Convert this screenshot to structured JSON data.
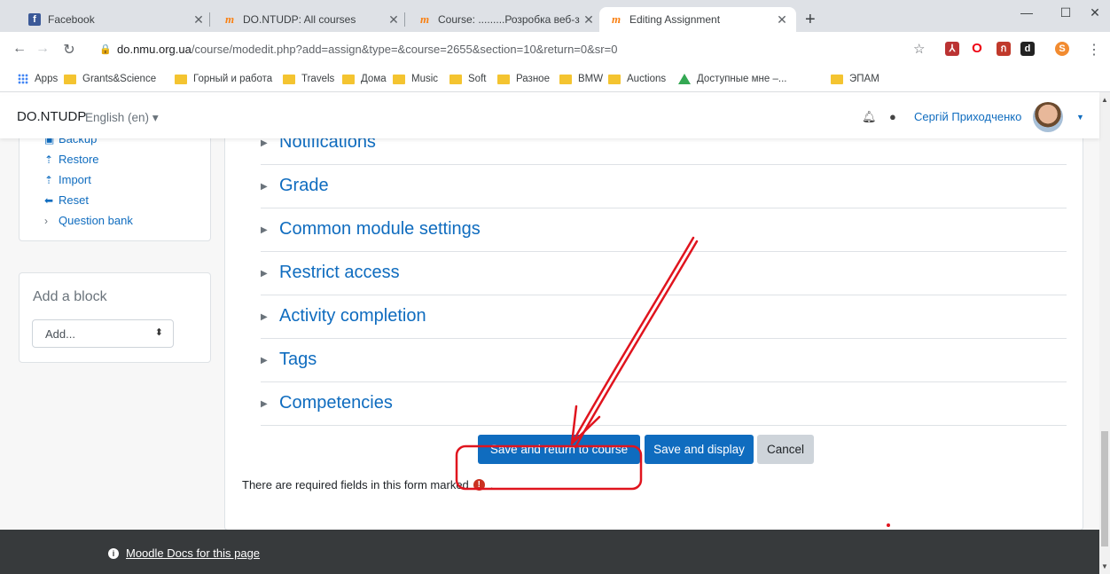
{
  "browser": {
    "tabs": [
      {
        "title": "Facebook",
        "icon": "facebook-icon"
      },
      {
        "title": "DO.NTUDP: All courses",
        "icon": "moodle-icon"
      },
      {
        "title": "Course: .........Розробка веб-застос",
        "icon": "moodle-icon"
      },
      {
        "title": "Editing Assignment",
        "icon": "moodle-icon",
        "active": true
      }
    ],
    "url_host": "do.nmu.org.ua",
    "url_path": "/course/modedit.php?add=assign&type=&course=2655&section=10&return=0&sr=0",
    "profile_letter": "S",
    "bookmarks": [
      "Apps",
      "Grants&Science",
      "Горный и работа",
      "Travels",
      "Дома",
      "Music",
      "Soft",
      "Разное",
      "BMW",
      "Auctions",
      "Доступные мне –...",
      "ЭПАМ"
    ]
  },
  "navbar": {
    "brand": "DO.NTUDP",
    "language": "English (en)",
    "username": "Сергій Приходченко"
  },
  "sidebar": {
    "items": [
      {
        "label": "Backup",
        "icon": "backup-icon"
      },
      {
        "label": "Restore",
        "icon": "upload-icon"
      },
      {
        "label": "Import",
        "icon": "upload-icon"
      },
      {
        "label": "Reset",
        "icon": "arrow-left-icon"
      },
      {
        "label": "Question bank",
        "icon": "chevron-right-icon"
      }
    ],
    "add_block": {
      "title": "Add a block",
      "select_value": "Add..."
    }
  },
  "form": {
    "sections": [
      "Notifications",
      "Grade",
      "Common module settings",
      "Restrict access",
      "Activity completion",
      "Tags",
      "Competencies"
    ],
    "buttons": {
      "save_return": "Save and return to course",
      "save_display": "Save and display",
      "cancel": "Cancel"
    },
    "required_note_before": "There are required fields in this form marked",
    "required_note_after": "."
  },
  "footer": {
    "docs_link": "Moodle Docs for this page"
  },
  "colors": {
    "primary": "#0f6cbf",
    "annotation": "#e0141e",
    "footer": "#373a3c"
  }
}
